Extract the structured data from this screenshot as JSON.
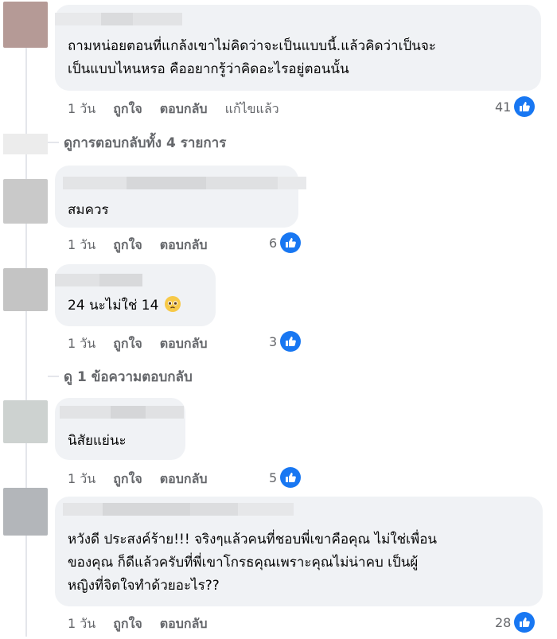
{
  "comments": [
    {
      "text_lines": [
        "ถามหน่อยตอนที่แกล้งเขาไม่คิดว่าจะเป็นแบบนี้.แล้วคิดว่าเป็นจะ",
        "เป็นแบบไหนหรอ คืออยากรู้ว่าคิดอะไรอยู่ตอนนั้น"
      ],
      "time": "1 วัน",
      "like_label": "ถูกใจ",
      "reply_label": "ตอบกลับ",
      "edited_label": "แก้ไขแล้ว",
      "reaction_count": "41"
    },
    {
      "text_lines": [
        "สมควร"
      ],
      "time": "1 วัน",
      "like_label": "ถูกใจ",
      "reply_label": "ตอบกลับ",
      "reaction_count": "6"
    },
    {
      "text_lines": [
        "24 นะไม่ใช่ 14"
      ],
      "emoji": "pleading-face",
      "time": "1 วัน",
      "like_label": "ถูกใจ",
      "reply_label": "ตอบกลับ",
      "reaction_count": "3"
    },
    {
      "text_lines": [
        "นิสัยแย่นะ"
      ],
      "time": "1 วัน",
      "like_label": "ถูกใจ",
      "reply_label": "ตอบกลับ",
      "reaction_count": "5"
    },
    {
      "text_lines": [
        "หวังดี ประสงค์ร้าย!!! จริงๆแล้วคนที่ชอบพี่เขาคือคุณ ไม่ใช่เพื่อน",
        "ของคุณ ก็ดีแล้วครับที่พี่เขาโกรธคุณเพราะคุณไม่น่าคบ เป็นผู้",
        "หญิงที่จิตใจทำด้วยอะไร??"
      ],
      "time": "1 วัน",
      "like_label": "ถูกใจ",
      "reply_label": "ตอบกลับ",
      "reaction_count": "28"
    }
  ],
  "more_replies_1": "ดูการตอบกลับทั้ง 4 รายการ",
  "more_replies_2": "ดู 1 ข้อความตอบกลับ",
  "colors": {
    "bubble": "#f0f2f5",
    "meta": "#65676b",
    "like_blue": "#1877f2"
  }
}
